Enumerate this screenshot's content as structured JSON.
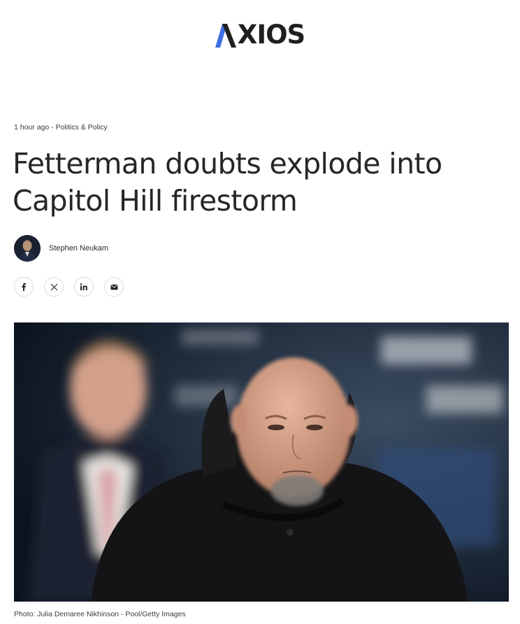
{
  "brand": {
    "name": "AXIOS",
    "logo_text": "XIOS",
    "accent_color": "#3e6fe0"
  },
  "article": {
    "time": "1 hour ago",
    "separator": " - ",
    "category": "Politics & Policy",
    "headline": "Fetterman doubts explode into Capitol Hill firestorm",
    "author": "Stephen Neukam",
    "photo_caption": "Photo: Julia Demaree Nikhinson - Pool/Getty Images"
  },
  "share": {
    "icons": [
      "facebook-icon",
      "x-icon",
      "linkedin-icon",
      "email-icon"
    ]
  }
}
